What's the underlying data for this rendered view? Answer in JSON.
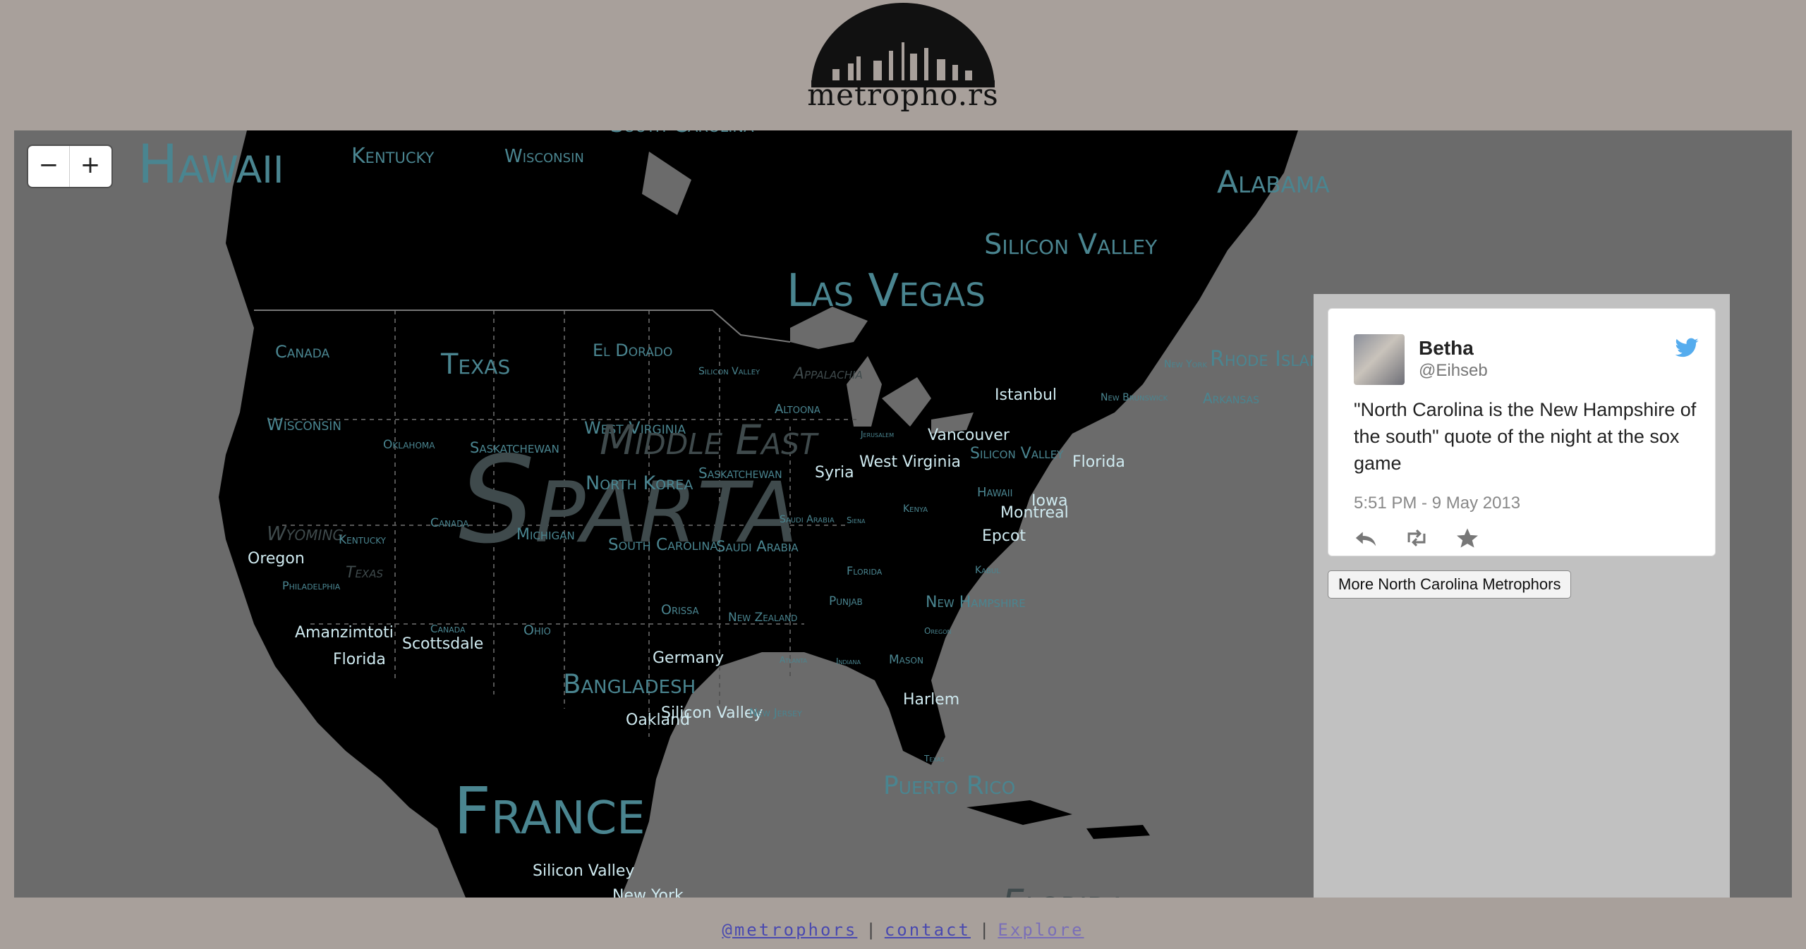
{
  "logo": {
    "text": "metropho.rs"
  },
  "map": {
    "zoom_out_label": "−",
    "zoom_in_label": "+",
    "labels": [
      {
        "text": "Hawaii",
        "kind": "state"
      },
      {
        "text": "Kentucky",
        "kind": "state"
      },
      {
        "text": "Wisconsin",
        "kind": "state"
      },
      {
        "text": "South Carolina",
        "kind": "state"
      },
      {
        "text": "Alabama",
        "kind": "state"
      },
      {
        "text": "Silicon Valley",
        "kind": "state"
      },
      {
        "text": "Las Vegas",
        "kind": "state"
      },
      {
        "text": "Canada",
        "kind": "state"
      },
      {
        "text": "Texas",
        "kind": "state"
      },
      {
        "text": "El Dorado",
        "kind": "state"
      },
      {
        "text": "Silicon Valley",
        "kind": "state"
      },
      {
        "text": "Appalachia",
        "kind": "ghost"
      },
      {
        "text": "Rhode Island",
        "kind": "state"
      },
      {
        "text": "New York",
        "kind": "state"
      },
      {
        "text": "New Brunswick",
        "kind": "state"
      },
      {
        "text": "Arkansas",
        "kind": "state"
      },
      {
        "text": "Istanbul",
        "kind": "city"
      },
      {
        "text": "Altoona",
        "kind": "state"
      },
      {
        "text": "Wisconsin",
        "kind": "state"
      },
      {
        "text": "West Virginia",
        "kind": "state"
      },
      {
        "text": "Oklahoma",
        "kind": "state"
      },
      {
        "text": "Saskatchewan",
        "kind": "state"
      },
      {
        "text": "Middle East",
        "kind": "ghost"
      },
      {
        "text": "Jerusalem",
        "kind": "state"
      },
      {
        "text": "Vancouver",
        "kind": "city"
      },
      {
        "text": "Silicon Valley",
        "kind": "state"
      },
      {
        "text": "West Virginia",
        "kind": "city"
      },
      {
        "text": "Florida",
        "kind": "city"
      },
      {
        "text": "Sparta",
        "kind": "ghost"
      },
      {
        "text": "North Korea",
        "kind": "state"
      },
      {
        "text": "Saskatchewan",
        "kind": "state"
      },
      {
        "text": "Syria",
        "kind": "city"
      },
      {
        "text": "Hawaii",
        "kind": "state"
      },
      {
        "text": "Iowa",
        "kind": "city"
      },
      {
        "text": "Kenya",
        "kind": "state"
      },
      {
        "text": "Montreal",
        "kind": "city"
      },
      {
        "text": "Saudi Arabia",
        "kind": "state"
      },
      {
        "text": "Siena",
        "kind": "state"
      },
      {
        "text": "Epcot",
        "kind": "city"
      },
      {
        "text": "Wyoming",
        "kind": "ghost"
      },
      {
        "text": "Canada",
        "kind": "state"
      },
      {
        "text": "Michigan",
        "kind": "state"
      },
      {
        "text": "Kentucky",
        "kind": "state"
      },
      {
        "text": "Oregon",
        "kind": "city"
      },
      {
        "text": "Texas",
        "kind": "ghost"
      },
      {
        "text": "South Carolina",
        "kind": "state"
      },
      {
        "text": "Saudi Arabia",
        "kind": "state"
      },
      {
        "text": "Philadelphia",
        "kind": "state"
      },
      {
        "text": "Florida",
        "kind": "state"
      },
      {
        "text": "Kabul",
        "kind": "state"
      },
      {
        "text": "Punjab",
        "kind": "state"
      },
      {
        "text": "New Hampshire",
        "kind": "state"
      },
      {
        "text": "Orissa",
        "kind": "state"
      },
      {
        "text": "New Zealand",
        "kind": "state"
      },
      {
        "text": "Oregon",
        "kind": "state"
      },
      {
        "text": "Amanzimtoti",
        "kind": "city"
      },
      {
        "text": "Canada",
        "kind": "state"
      },
      {
        "text": "Ohio",
        "kind": "state"
      },
      {
        "text": "Scottsdale",
        "kind": "city"
      },
      {
        "text": "Florida",
        "kind": "city"
      },
      {
        "text": "Germany",
        "kind": "city"
      },
      {
        "text": "Atlanta",
        "kind": "state"
      },
      {
        "text": "Indiana",
        "kind": "state"
      },
      {
        "text": "Mason",
        "kind": "state"
      },
      {
        "text": "Bangladesh",
        "kind": "state"
      },
      {
        "text": "Harlem",
        "kind": "city"
      },
      {
        "text": "Silicon Valley",
        "kind": "city"
      },
      {
        "text": "New Jersey",
        "kind": "state"
      },
      {
        "text": "Oakland",
        "kind": "city"
      },
      {
        "text": "Texas",
        "kind": "state"
      },
      {
        "text": "France",
        "kind": "state"
      },
      {
        "text": "Puerto Rico",
        "kind": "state"
      },
      {
        "text": "Silicon Valley",
        "kind": "city"
      },
      {
        "text": "New York",
        "kind": "city"
      },
      {
        "text": "Florida",
        "kind": "ghost"
      }
    ]
  },
  "tweet": {
    "name": "Betha",
    "handle": "@Eihseb",
    "text": "\"North Carolina is the New Hampshire of the south\" quote of the night at the sox game",
    "time": "5:51 PM - 9 May 2013"
  },
  "panel": {
    "more_button": "More North Carolina Metrophors"
  },
  "footer": {
    "link1": "@metrophors",
    "sep": "|",
    "link2": "contact",
    "link3": "Explore"
  },
  "colors": {
    "background": "#a8a09b",
    "water": "#6b6b6b",
    "land": "#000000",
    "label": "#4a8590",
    "city": "#cfeaf0"
  }
}
